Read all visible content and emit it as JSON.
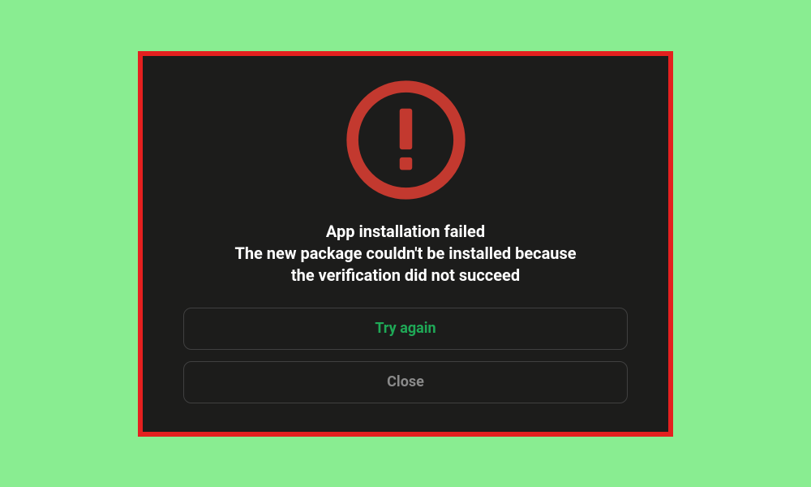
{
  "colors": {
    "page_bg": "#89ed91",
    "frame_border": "#e4201f",
    "dialog_bg": "#1c1c1b",
    "warning_ring": "#c3392f",
    "text_white": "#ffffff",
    "primary_green": "#1fa957",
    "secondary_grey": "#8a8a8a",
    "button_border": "#404040"
  },
  "icon": {
    "name": "warning-icon"
  },
  "message": {
    "line1": "App installation failed",
    "line2": "The new package couldn't be installed because",
    "line3": "the verification did not succeed"
  },
  "buttons": {
    "primary": "Try again",
    "secondary": "Close"
  }
}
